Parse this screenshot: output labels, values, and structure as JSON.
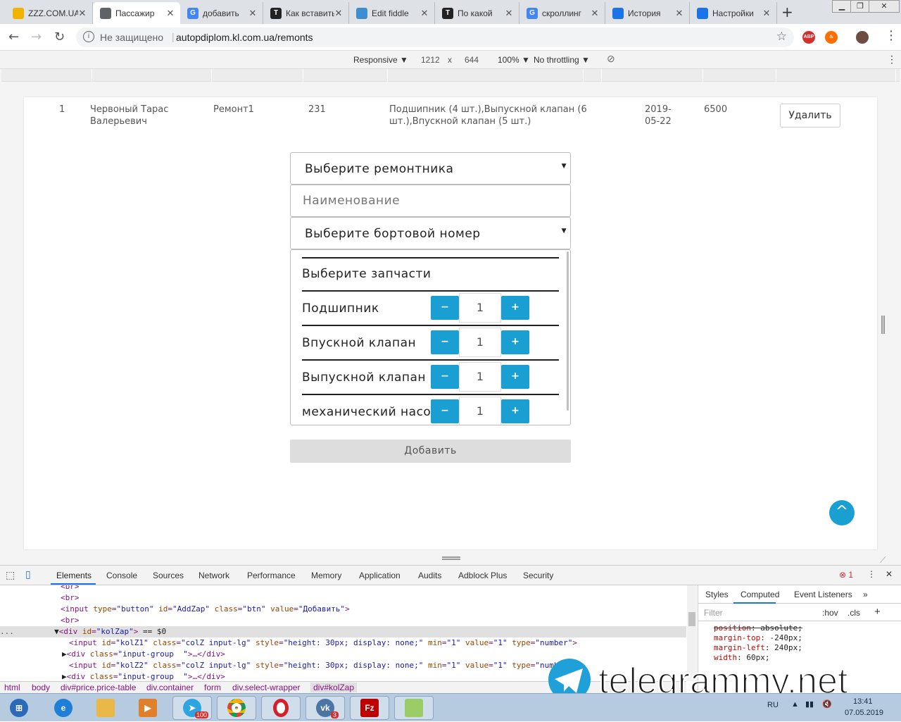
{
  "browser": {
    "tabs": [
      {
        "title": "ZZZ.COM.UA",
        "fav_color": "#f0b400",
        "fav_char": "",
        "active": false
      },
      {
        "title": "Пассажир",
        "fav_color": "#5f6368",
        "fav_char": "",
        "active": true
      },
      {
        "title": "добавить",
        "fav_color": "#4285f4",
        "fav_char": "G",
        "active": false
      },
      {
        "title": "Как вставить",
        "fav_color": "#222",
        "fav_char": "T",
        "active": false
      },
      {
        "title": "Edit fiddle",
        "fav_color": "#3e8ed0",
        "fav_char": "",
        "active": false
      },
      {
        "title": "По какой",
        "fav_color": "#222",
        "fav_char": "T",
        "active": false
      },
      {
        "title": "скроллинг",
        "fav_color": "#4285f4",
        "fav_char": "G",
        "active": false
      },
      {
        "title": "История",
        "fav_color": "#1a73e8",
        "fav_char": "",
        "active": false
      },
      {
        "title": "Настройки",
        "fav_color": "#1a73e8",
        "fav_char": "",
        "active": false
      }
    ],
    "new_tab": "+",
    "tab_close": "✕",
    "security_label": "Не защищено",
    "url": "autopdiplom.kl.com.ua/remonts",
    "ext_abp": "ABP"
  },
  "device_toolbar": {
    "mode": "Responsive",
    "width": "1212",
    "times": "x",
    "height": "644",
    "zoom": "100%",
    "throttling": "No throttling"
  },
  "table_row": {
    "num": "1",
    "name": "Червоный Тарас Валерьевич",
    "repair": "Ремонт1",
    "board": "231",
    "parts": "Подшипник (4 шт.),Выпускной клапан (6 шт.),Впускной клапан (5 шт.)",
    "date": "2019-05-22",
    "price": "6500",
    "delete_label": "Удалить"
  },
  "form": {
    "select_mechanic": "Выберите ремонтника",
    "name_placeholder": "Наименование",
    "select_board": "Выберите бортовой номер",
    "parts_header": "Выберите запчасти",
    "parts": [
      {
        "label": "Подшипник",
        "qty": "1"
      },
      {
        "label": "Впускной клапан",
        "qty": "1"
      },
      {
        "label": "Выпускной клапан",
        "qty": "1"
      },
      {
        "label": "механический насос",
        "qty": "1"
      }
    ],
    "minus": "−",
    "plus": "+",
    "add_label": "Добавить",
    "up_arrow": "^"
  },
  "devtools": {
    "tabs": [
      "Elements",
      "Console",
      "Sources",
      "Network",
      "Performance",
      "Memory",
      "Application",
      "Audits",
      "Adblock Plus",
      "Security"
    ],
    "error_count": "1",
    "crumbs": [
      "html",
      "body",
      "div#price.price-table",
      "div.container",
      "form",
      "div.select-wrapper",
      "div#kolZap"
    ],
    "styles_tabs": [
      "Styles",
      "Computed",
      "Event Listeners"
    ],
    "filter_placeholder": "Filter",
    "hov": ":hov",
    "cls": ".cls",
    "css_lines": [
      {
        "prop": "position",
        "val": "absolute",
        "struck": true
      },
      {
        "prop": "margin-top",
        "val": "-240px",
        "struck": false
      },
      {
        "prop": "margin-left",
        "val": "240px",
        "struck": false
      },
      {
        "prop": "width",
        "val": "60px",
        "struck": false
      }
    ]
  },
  "watermark": "telegrammy.net",
  "taskbar": {
    "lang": "RU",
    "time": "13:41",
    "date": "07.05.2019",
    "badge_telegram": "100",
    "badge_vk": "3"
  }
}
